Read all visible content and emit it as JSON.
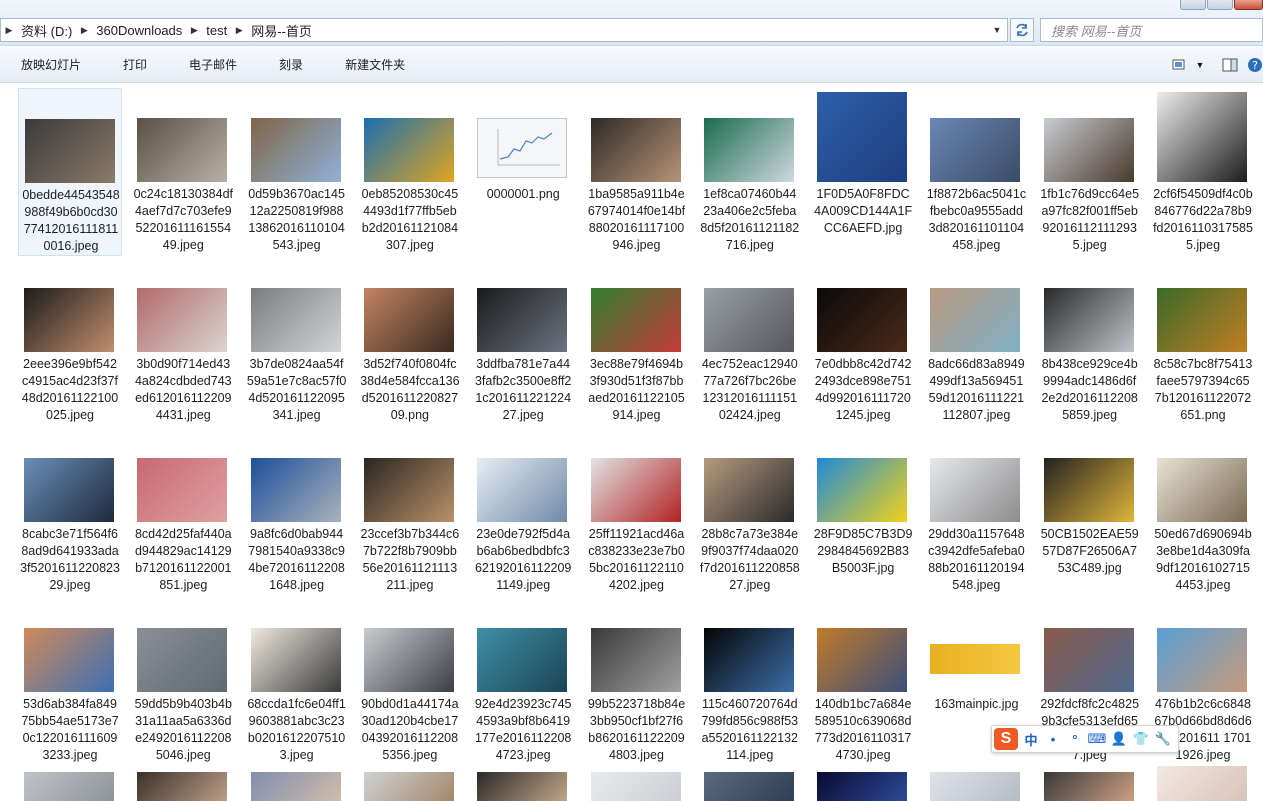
{
  "address": {
    "crumbs": [
      "资料 (D:)",
      "360Downloads",
      "test",
      "网易--首页"
    ],
    "search_placeholder": "搜索 网易--首页"
  },
  "toolbar": {
    "buttons": [
      "放映幻灯片",
      "打印",
      "电子邮件",
      "刻录",
      "新建文件夹"
    ]
  },
  "files": [
    {
      "name": "0bedde44543548988f49b6b0cd30774120161118110016.jpeg",
      "colors": [
        "#3a3a3a",
        "#8b7a6a"
      ]
    },
    {
      "name": "0c24c18130384df4aef7d7c703efe95220161116155449.jpeg",
      "colors": [
        "#5a5045",
        "#b9b0a4"
      ]
    },
    {
      "name": "0d59b3670ac14512a2250819f98813862016110104543.jpeg",
      "colors": [
        "#7f6548",
        "#8fb1d8"
      ]
    },
    {
      "name": "0eb85208530c454493d1f77ffb5ebb2d20161121084307.jpeg",
      "colors": [
        "#1a6fb0",
        "#e0a420"
      ]
    },
    {
      "name": "0000001.png",
      "colors": [
        "#f4f6f8",
        "#4f7fc6"
      ]
    },
    {
      "name": "1ba9585a911b4e67974014f0e14bf88020161117100946.jpeg",
      "colors": [
        "#2e2a27",
        "#b79378"
      ]
    },
    {
      "name": "1ef8ca07460b4423a406e2c5feba8d5f20161121182716.jpeg",
      "colors": [
        "#1b6c4f",
        "#cfd8df"
      ]
    },
    {
      "name": "1F0D5A0F8FDC4A009CD144A1FCC6AEFD.jpg",
      "colors": [
        "#2e5faa",
        "#1e3e80"
      ]
    },
    {
      "name": "1f8872b6ac5041cfbebc0a9555add3d820161101104458.jpeg",
      "colors": [
        "#6b87b6",
        "#3a4b66"
      ]
    },
    {
      "name": "1fb1c76d9cc64e5a97fc82f001ff5eb920161121112935.jpeg",
      "colors": [
        "#c8ccd2",
        "#4a3a2c"
      ]
    },
    {
      "name": "2cf6f54509df4c0b846776d22a78b9fd20161103175855.jpeg",
      "colors": [
        "#ededed",
        "#1d1d1d"
      ]
    },
    {
      "name": "2eee396e9bf542c4915ac4d23f37f48d20161122100025.jpeg",
      "colors": [
        "#1c1c1c",
        "#c08e6c"
      ]
    },
    {
      "name": "3b0d90f714ed434a824cdbded743ed6120161122094431.jpeg",
      "colors": [
        "#b26b69",
        "#d9d4d0"
      ]
    },
    {
      "name": "3b7de0824aa54f59a51e7c8ac57f04d520161122095341.jpeg",
      "colors": [
        "#7b7c7e",
        "#d2d5d8"
      ]
    },
    {
      "name": "3d52f740f0804fc38d4e584fcca136d520161122082709.png",
      "colors": [
        "#c28461",
        "#3a2a20"
      ]
    },
    {
      "name": "3ddfba781e7a443fafb2c3500e8ff21c20161122122427.jpeg",
      "colors": [
        "#1a1a1a",
        "#6b7480"
      ]
    },
    {
      "name": "3ec88e79f4694b3f930d51f3f87bbaed20161122105914.jpeg",
      "colors": [
        "#2f7d2d",
        "#c43c3c"
      ]
    },
    {
      "name": "4ec752eac1294077a726f7bc26be1231201611115102424.jpeg",
      "colors": [
        "#9aa0a6",
        "#55585c"
      ]
    },
    {
      "name": "7e0dbb8c42d7422493dce898e7514d9920161117201245.jpeg",
      "colors": [
        "#0a0a0a",
        "#4a2a18"
      ]
    },
    {
      "name": "8adc66d83a8949499df13a56945159d12016111221112807.jpeg",
      "colors": [
        "#b89b82",
        "#7fb0c6"
      ]
    },
    {
      "name": "8b438ce929ce4b9994adc1486d6f2e2d20161122085859.jpeg",
      "colors": [
        "#2a2a2a",
        "#bfc4c8"
      ]
    },
    {
      "name": "8c58c7bc8f75413faee5797394c657b120161122072651.png",
      "colors": [
        "#3b6a2a",
        "#c27e23"
      ]
    },
    {
      "name": "8cabc3e71f564f68ad9d641933ada3f520161122082329.jpeg",
      "colors": [
        "#6a8fb8",
        "#1d2a3c"
      ]
    },
    {
      "name": "8cd42d25faf440ad944829ac14129b7120161122001851.jpeg",
      "colors": [
        "#c76a70",
        "#e0a0a0"
      ]
    },
    {
      "name": "9a8fc6d0bab9447981540a9338c94be720161122081648.jpeg",
      "colors": [
        "#1d4f9a",
        "#a9b2bb"
      ]
    },
    {
      "name": "23ccef3b7b344c67b722f8b7909bb56e20161121113211.jpeg",
      "colors": [
        "#2b2622",
        "#b89268"
      ]
    },
    {
      "name": "23e0de792f5d4ab6ab6bedbdbfc3621920161122091149.jpeg",
      "colors": [
        "#e7edf3",
        "#6f8aa8"
      ]
    },
    {
      "name": "25ff11921acd46ac838233e23e7b05bc201611221104202.jpeg",
      "colors": [
        "#e2e3e4",
        "#b22222"
      ]
    },
    {
      "name": "28b8c7a73e384e9f9037f74daa020f7d20161122085827.jpeg",
      "colors": [
        "#b79b7f",
        "#2a2a2a"
      ]
    },
    {
      "name": "28F9D85C7B3D92984845692B83B5003F.jpg",
      "colors": [
        "#1f8ad9",
        "#f0d21a"
      ]
    },
    {
      "name": "29dd30a1157648c3942dfe5afeba088b20161120194548.jpeg",
      "colors": [
        "#e6e8eb",
        "#8c8c8c"
      ]
    },
    {
      "name": "50CB1502EAE5957D87F26506A753C489.jpg",
      "colors": [
        "#222222",
        "#e0b53a"
      ]
    },
    {
      "name": "50ed67d690694b3e8be1d4a309fa9df120161027154453.jpeg",
      "colors": [
        "#e8e2d4",
        "#7a6a52"
      ]
    },
    {
      "name": "53d6ab384fa84975bb54ae5173e70c1220161116093233.jpeg",
      "colors": [
        "#d08a5c",
        "#3b6fb2"
      ]
    },
    {
      "name": "59dd5b9b403b4b31a11aa5a6336de24920161122085046.jpeg",
      "colors": [
        "#8a8f96",
        "#5f6a70"
      ]
    },
    {
      "name": "68ccda1fc6e04ff19603881abc3c23b02016122075103.jpeg",
      "colors": [
        "#efeadf",
        "#3a3a3a"
      ]
    },
    {
      "name": "90bd0d1a44174a30ad120b4cbe17043920161122085356.jpeg",
      "colors": [
        "#c9cccf",
        "#3a3f45"
      ]
    },
    {
      "name": "92e4d23923c7454593a9bf8b6419177e20161122084723.jpeg",
      "colors": [
        "#3f8fa6",
        "#1b4454"
      ]
    },
    {
      "name": "99b5223718b84e3bb950cf1bf27f6b86201611222094803.jpeg",
      "colors": [
        "#3a3a3a",
        "#a0a0a0"
      ]
    },
    {
      "name": "115c460720764d799fd856c988f53a5520161122132114.jpeg",
      "colors": [
        "#050505",
        "#3b6ea8"
      ]
    },
    {
      "name": "140db1bc7a684e589510c639068d773d20161103174730.jpeg",
      "colors": [
        "#c27a2a",
        "#3b4f7a"
      ]
    },
    {
      "name": "163mainpic.jpg",
      "colors": [
        "#ffffff",
        "#e8b020"
      ]
    },
    {
      "name": "292fdcf8fc2c48259b3cfe5313efd654201611220 94747.jpeg",
      "colors": [
        "#8a5a4a",
        "#4f6a8f"
      ]
    },
    {
      "name": "476b1b2c6c684867b0d66bd8d6d6f6d3201611 17011926.jpeg",
      "colors": [
        "#5a9fd6",
        "#c69a7a"
      ]
    }
  ],
  "partial_row_colors": [
    [
      "#bfc3c8",
      "#8a8f96"
    ],
    [
      "#3a302a",
      "#c8a890"
    ],
    [
      "#7f8fb0",
      "#d8c0a8"
    ],
    [
      "#cfd2d4",
      "#a08060"
    ],
    [
      "#2a2a2a",
      "#d0b090"
    ],
    [
      "#e8ebee",
      "#c8ccd0"
    ],
    [
      "#5a6a80",
      "#2a3a50"
    ],
    [
      "#0a0a30",
      "#3050a0"
    ],
    [
      "#dfe4ea",
      "#b0b8c0"
    ],
    [
      "#3a3a3a",
      "#d8a888"
    ],
    [
      "#f2e8e2",
      "#d8c2b8"
    ]
  ],
  "ime": {
    "logo": "S",
    "items": [
      "中",
      "•",
      "°",
      "⌨",
      "👤",
      "👕",
      "🔧"
    ]
  },
  "accent": "#3399ff"
}
